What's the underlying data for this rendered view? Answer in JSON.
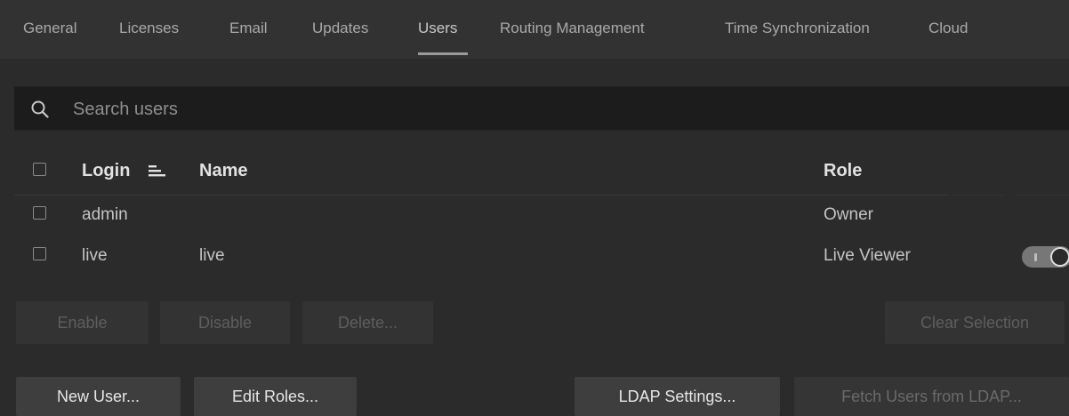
{
  "tabs": [
    {
      "label": "General"
    },
    {
      "label": "Licenses"
    },
    {
      "label": "Email"
    },
    {
      "label": "Updates"
    },
    {
      "label": "Users",
      "active": true
    },
    {
      "label": "Routing Management"
    },
    {
      "label": "Time Synchronization"
    },
    {
      "label": "Cloud"
    }
  ],
  "search": {
    "placeholder": "Search users",
    "value": ""
  },
  "table": {
    "headers": {
      "login": "Login",
      "name": "Name",
      "role": "Role"
    },
    "sorted_by": "Login",
    "rows": [
      {
        "login": "admin",
        "name": "",
        "role": "Owner",
        "checked": false,
        "has_toggle": false
      },
      {
        "login": "live",
        "name": "live",
        "role": "Live Viewer",
        "checked": false,
        "has_toggle": true,
        "enabled": true
      }
    ]
  },
  "actions": {
    "enable": "Enable",
    "disable": "Disable",
    "delete": "Delete...",
    "clear_selection": "Clear Selection"
  },
  "footer": {
    "new_user": "New User...",
    "edit_roles": "Edit Roles...",
    "ldap_settings": "LDAP Settings...",
    "fetch_ldap": "Fetch Users from LDAP..."
  },
  "icons": {
    "search": "search-icon",
    "sort": "sort-ascending-icon"
  },
  "colors": {
    "background": "#2b2b2b",
    "tabbar": "#323232",
    "search_bg": "#1c1c1c"
  }
}
